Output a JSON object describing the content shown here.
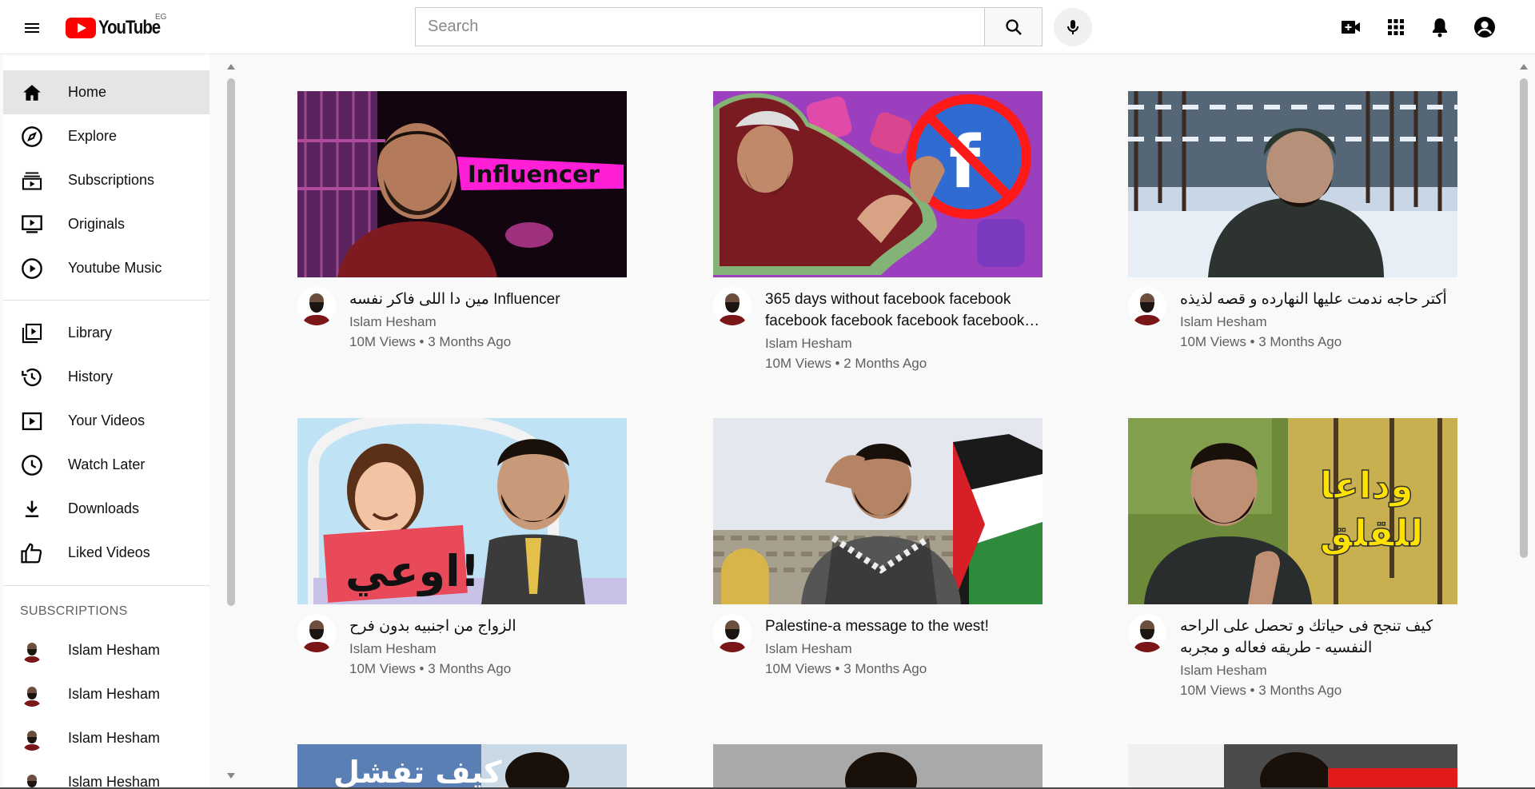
{
  "header": {
    "logo_text": "YouTube",
    "country_code": "EG",
    "search_placeholder": "Search"
  },
  "sidebar": {
    "main_items": [
      {
        "label": "Home",
        "icon": "home-icon",
        "active": true
      },
      {
        "label": "Explore",
        "icon": "compass-icon"
      },
      {
        "label": "Subscriptions",
        "icon": "subscriptions-icon"
      },
      {
        "label": "Originals",
        "icon": "originals-icon"
      },
      {
        "label": "Youtube Music",
        "icon": "music-icon"
      }
    ],
    "library_items": [
      {
        "label": "Library",
        "icon": "library-icon"
      },
      {
        "label": "History",
        "icon": "history-icon"
      },
      {
        "label": "Your Videos",
        "icon": "your-videos-icon"
      },
      {
        "label": "Watch Later",
        "icon": "clock-icon"
      },
      {
        "label": "Downloads",
        "icon": "download-icon"
      },
      {
        "label": "Liked Videos",
        "icon": "thumbs-up-icon"
      }
    ],
    "subscriptions_heading": "SUBSCRIPTIONS",
    "subscriptions": [
      {
        "name": "Islam Hesham"
      },
      {
        "name": "Islam Hesham"
      },
      {
        "name": "Islam Hesham"
      },
      {
        "name": "Islam Hesham"
      }
    ]
  },
  "videos": [
    {
      "title": "مين دا اللى فاكر نفسه Influencer",
      "channel": "Islam Hesham",
      "stats": "10M Views • 3 Months Ago",
      "thumb_text": "Influencer"
    },
    {
      "title": "365 days without facebook facebook facebook facebook facebook facebook facebook",
      "channel": "Islam Hesham",
      "stats": "10M Views • 2 Months Ago"
    },
    {
      "title": "أكتر حاجه ندمت عليها النهارده و قصه لذيذه",
      "channel": "Islam Hesham",
      "stats": "10M Views • 3 Months Ago"
    },
    {
      "title": "الزواج من اجنبيه بدون فرح",
      "channel": "Islam Hesham",
      "stats": "10M Views • 3 Months Ago",
      "thumb_text": "اوعي!"
    },
    {
      "title": "Palestine-a message to the west!",
      "channel": "Islam Hesham",
      "stats": "10M Views • 3 Months Ago"
    },
    {
      "title": "كيف تنجح فى حياتك و تحصل على الراحه النفسيه - طريقه فعاله و مجربه",
      "channel": "Islam Hesham",
      "stats": "10M Views • 3 Months Ago",
      "thumb_text_line1": "وداعا",
      "thumb_text_line2": "للقلق"
    }
  ],
  "partial_row": {
    "thumb_text": "كيف تفشل"
  },
  "colors": {
    "accent": "#ff0000",
    "active_bg": "#e5e5e5",
    "secondary_text": "#606060"
  }
}
